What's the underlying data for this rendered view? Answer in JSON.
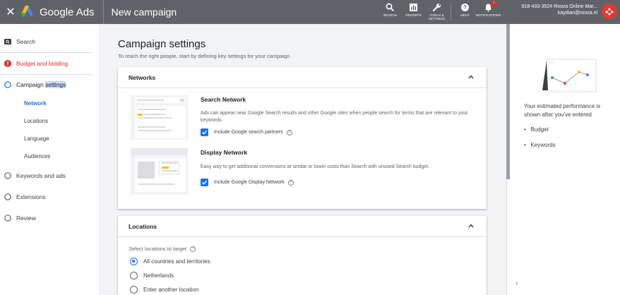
{
  "topbar": {
    "brand": "Google Ads",
    "title": "New campaign",
    "tools": [
      {
        "label": "SEARCH",
        "icon": "search-icon"
      },
      {
        "label": "REPORTS",
        "icon": "reports-icon"
      },
      {
        "label": "TOOLS & SETTINGS",
        "icon": "wrench-icon"
      },
      {
        "label": "HELP",
        "icon": "help-icon"
      },
      {
        "label": "NOTIFICATIONS",
        "icon": "bell-icon"
      }
    ],
    "notif_count": "!",
    "account_line1": "818-433-3524 Rooza Online Mar...",
    "account_line2": "kaydian@rooza.nl"
  },
  "nav": {
    "items": [
      {
        "label": "Search",
        "state": "done"
      },
      {
        "label": "Budget and bidding",
        "state": "error"
      },
      {
        "label": "Campaign settings",
        "label_a": "Campaign ",
        "label_b": "settings",
        "state": "active"
      },
      {
        "label": "Keywords and ads",
        "state": "todo"
      },
      {
        "label": "Extensions",
        "state": "todo"
      },
      {
        "label": "Review",
        "state": "todo"
      }
    ],
    "subitems": [
      "Network",
      "Locations",
      "Language",
      "Audiences"
    ]
  },
  "main": {
    "title": "Campaign settings",
    "subtitle": "To reach the right people, start by defining key settings for your campaign",
    "networks": {
      "header": "Networks",
      "search_title": "Search Network",
      "search_desc": "Ads can appear near Google Search results and other Google sites when people search for terms that are relevant to your keywords.",
      "search_check": "Include Google search partners",
      "display_title": "Display Network",
      "display_desc": "Easy way to get additional conversions at similar or lower costs than Search with unused Search budget.",
      "display_check": "Include Google Display Network"
    },
    "locations": {
      "header": "Locations",
      "label": "Select locations to target",
      "options": [
        "All countries and territories",
        "Netherlands",
        "Enter another location"
      ],
      "selected": 0
    }
  },
  "right": {
    "perf_text": "Your estimated performance is shown after you've entered",
    "bullets": [
      "Budget",
      "Keywords"
    ],
    "expand_icon": "›"
  },
  "colors": {
    "topbar": "#5f6368",
    "accent": "#1a73e8",
    "error": "#d93025"
  }
}
